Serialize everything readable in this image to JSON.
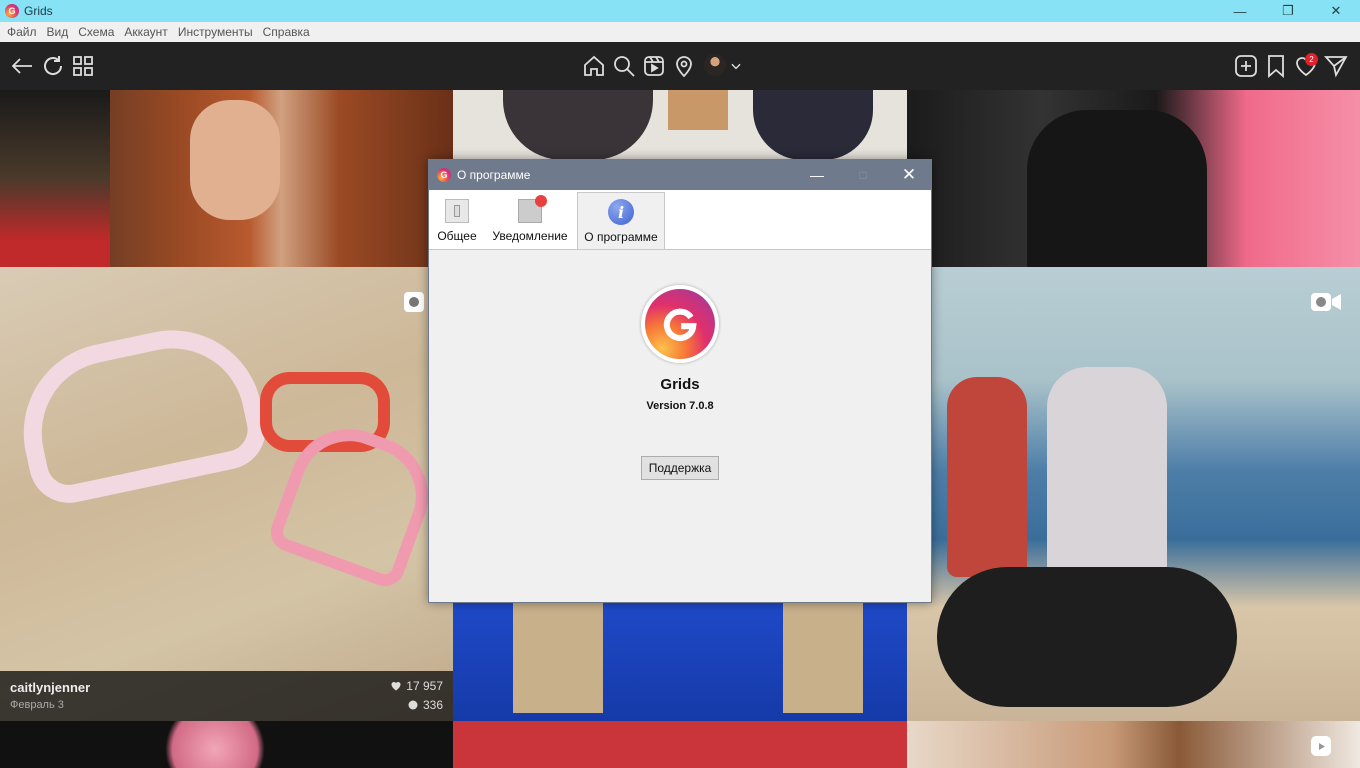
{
  "window": {
    "title": "Grids"
  },
  "menu": [
    "Файл",
    "Вид",
    "Схема",
    "Аккаунт",
    "Инструменты",
    "Справка"
  ],
  "toolbar": {
    "notification_count": "2"
  },
  "posts": [
    {
      "username": "caitlynjenner",
      "date": "Февраль 3",
      "likes": "17 957",
      "comments": "336"
    }
  ],
  "dialog": {
    "title": "О программе",
    "tabs": [
      {
        "label": "Общее",
        "icon": "general-settings-icon"
      },
      {
        "label": "Уведомление",
        "icon": "notification-icon"
      },
      {
        "label": "О программе",
        "icon": "info-icon",
        "active": true
      }
    ],
    "app_name": "Grids",
    "version": "Version 7.0.8",
    "support_label": "Поддержка"
  },
  "colors": {
    "titlebar": "#86e2f4",
    "toolbar": "#222222",
    "dialog_title": "#6f7a8c",
    "badge": "#e0202a"
  }
}
